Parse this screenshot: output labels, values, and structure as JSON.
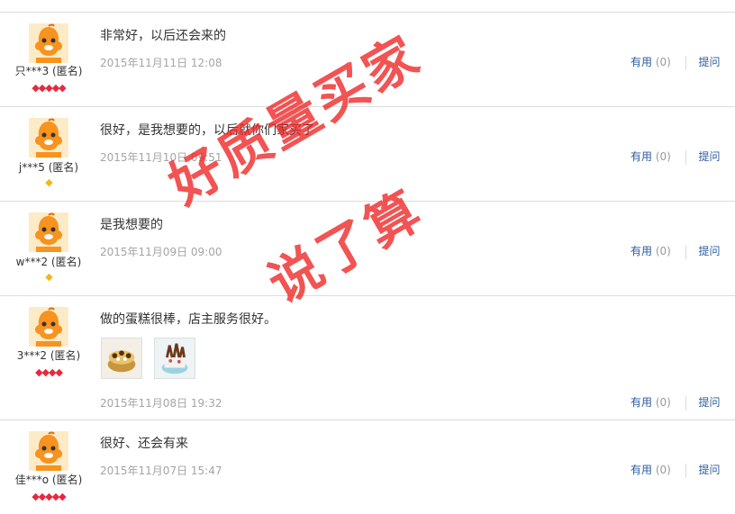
{
  "reviews": [
    {
      "user": "只***3 (匿名)",
      "rank": "◆◆◆◆◆",
      "rank_color": "#e8283c",
      "text": "非常好，以后还会来的",
      "date": "2015年11月11日 12:08",
      "useful": "有用",
      "count": "(0)",
      "ask": "提问"
    },
    {
      "user": "j***5 (匿名)",
      "rank": "◆",
      "rank_color": "#f1b81c",
      "text": "很好，是我想要的，以后就你们家买了",
      "date": "2015年11月10日 09:51",
      "useful": "有用",
      "count": "(0)",
      "ask": "提问"
    },
    {
      "user": "w***2 (匿名)",
      "rank": "◆",
      "rank_color": "#f1b81c",
      "text": "是我想要的",
      "date": "2015年11月09日 09:00",
      "useful": "有用",
      "count": "(0)",
      "ask": "提问"
    },
    {
      "user": "3***2 (匿名)",
      "rank": "◆◆◆◆",
      "rank_color": "#e8283c",
      "text": "做的蛋糕很棒，店主服务很好。",
      "date": "2015年11月08日 19:32",
      "useful": "有用",
      "count": "(0)",
      "ask": "提问"
    },
    {
      "user": "佳***o (匿名)",
      "rank": "◆◆◆◆◆",
      "rank_color": "#e8283c",
      "text": "很好、还会有来",
      "date": "2015年11月07日 15:47",
      "useful": "有用",
      "count": "(0)",
      "ask": "提问"
    }
  ],
  "watermark": {
    "line1": "好质量买家",
    "line2": "说了算"
  },
  "colors": {
    "link": "#2a5d9f",
    "date": "#a5a5a5",
    "avatar": "#f7a21b",
    "border": "#dcdcdc"
  }
}
